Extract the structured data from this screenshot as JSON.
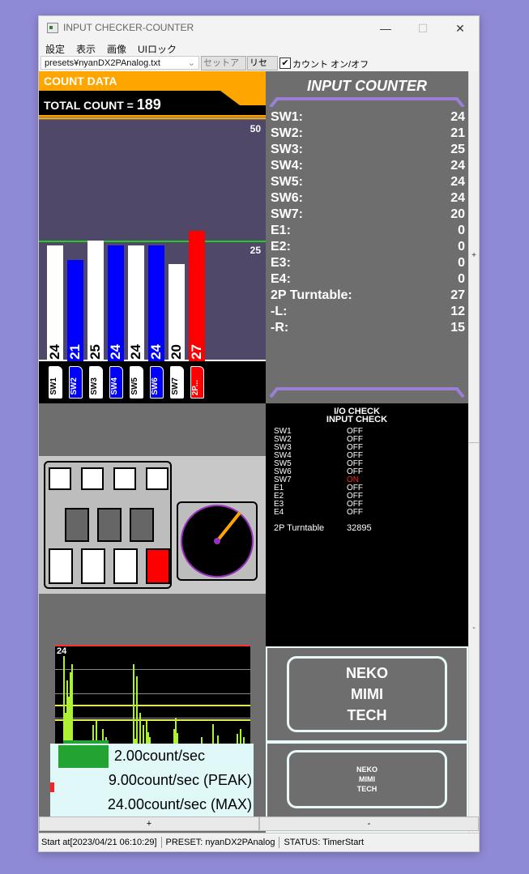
{
  "window": {
    "title": "INPUT CHECKER-COUNTER",
    "minimize": "—",
    "maximize": "☐",
    "close": "✕"
  },
  "menu": [
    "設定",
    "表示",
    "画像",
    "UIロック"
  ],
  "toolbar": {
    "preset_value": "presets¥nyanDX2PAnalog.txt",
    "setup_label": "セットアップ",
    "reset_label": "リセット",
    "count_toggle_label": "カウント オン/オフ",
    "count_toggle_checked": true
  },
  "count_data": {
    "header": "COUNT DATA",
    "total_label": "TOTAL COUNT = ",
    "total_value": "189"
  },
  "chart_data": {
    "type": "bar",
    "categories": [
      "SW1",
      "SW2",
      "SW3",
      "SW4",
      "SW5",
      "SW6",
      "SW7",
      "2P..."
    ],
    "values": [
      24,
      21,
      25,
      24,
      24,
      24,
      20,
      27
    ],
    "colors": [
      "#ffffff",
      "#0000ff",
      "#ffffff",
      "#0000ff",
      "#ffffff",
      "#0000ff",
      "#ffffff",
      "#ff0000"
    ],
    "ylim": [
      0,
      50
    ],
    "tick_labels": [
      "50",
      "25"
    ],
    "reference_line": 25,
    "reference_color": "#22cc22"
  },
  "input_counter": {
    "title": "INPUT COUNTER",
    "rows": [
      {
        "label": "SW1:",
        "value": "24"
      },
      {
        "label": "SW2:",
        "value": "21"
      },
      {
        "label": "SW3:",
        "value": "25"
      },
      {
        "label": "SW4:",
        "value": "24"
      },
      {
        "label": "SW5:",
        "value": "24"
      },
      {
        "label": "SW6:",
        "value": "24"
      },
      {
        "label": "SW7:",
        "value": "20"
      },
      {
        "label": "E1:",
        "value": "0"
      },
      {
        "label": "E2:",
        "value": "0"
      },
      {
        "label": "E3:",
        "value": "0"
      },
      {
        "label": "E4:",
        "value": "0"
      },
      {
        "label": "2P Turntable:",
        "value": "27"
      },
      {
        "label": "-L:",
        "value": "12"
      },
      {
        "label": "-R:",
        "value": "15"
      }
    ]
  },
  "io_check": {
    "title1": "I/O CHECK",
    "title2": "INPUT CHECK",
    "rows": [
      {
        "label": "SW1",
        "state": "OFF"
      },
      {
        "label": "SW2",
        "state": "OFF"
      },
      {
        "label": "SW3",
        "state": "OFF"
      },
      {
        "label": "SW4",
        "state": "OFF"
      },
      {
        "label": "SW5",
        "state": "OFF"
      },
      {
        "label": "SW6",
        "state": "OFF"
      },
      {
        "label": "SW7",
        "state": "ON"
      },
      {
        "label": "E1",
        "state": "OFF"
      },
      {
        "label": "E2",
        "state": "OFF"
      },
      {
        "label": "E3",
        "state": "OFF"
      },
      {
        "label": "E4",
        "state": "OFF"
      }
    ],
    "turntable_label": "2P Turntable",
    "turntable_value": "32895"
  },
  "controller": {
    "pressed_key": "SW7 (red)",
    "turntable_angle_deg": 55
  },
  "rate": {
    "graph_max": "24",
    "current": "2.00count/sec",
    "peak": "9.00count/sec (PEAK)",
    "max": "24.00count/sec (MAX)",
    "current_fraction": 0.083
  },
  "branding": {
    "line1": "NEKO",
    "line2": "MIMI",
    "line3": "TECH"
  },
  "scroll": {
    "plus": "+",
    "minus": "-"
  },
  "bottom_buttons": {
    "plus": "+",
    "minus": "-"
  },
  "status": {
    "start": "Start at[2023/04/21 06:10:29]",
    "preset": "PRESET:  nyanDX2PAnalog",
    "status": "STATUS:  TimerStart"
  }
}
